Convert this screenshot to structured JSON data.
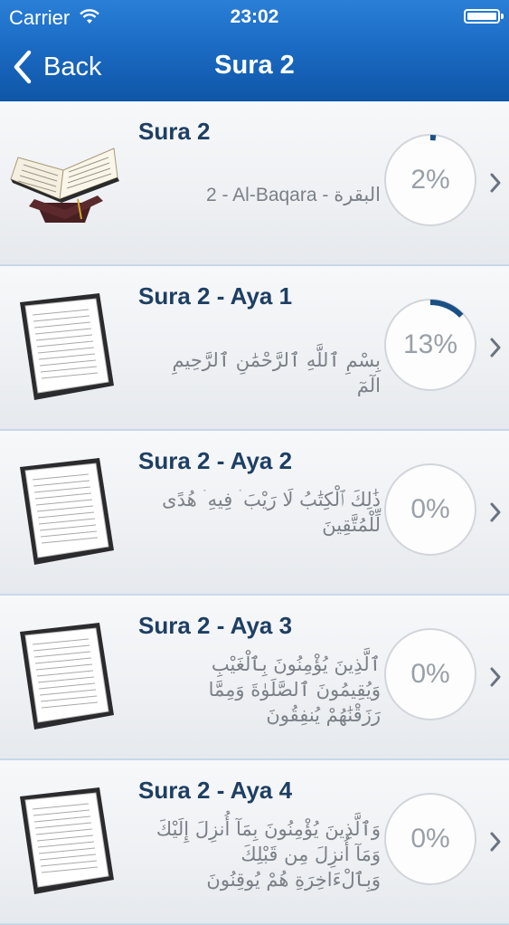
{
  "status": {
    "carrier": "Carrier",
    "time": "23:02"
  },
  "nav": {
    "back_label": "Back",
    "title": "Sura 2"
  },
  "colors": {
    "header": "#1b6bc4",
    "progress": "#1a4f86",
    "title_text": "#1e3f63"
  },
  "rows": [
    {
      "name": "Sura 2",
      "desc": "2 - Al-Baqara - البقرة",
      "progress_label": "2%",
      "progress": 0.02,
      "icon": "quran-book-icon"
    },
    {
      "name": "Sura 2 - Aya 1",
      "desc": "بِسْمِ ٱللَّهِ ٱلرَّحْمَٰنِ ٱلرَّحِيمِ الٓمٓ",
      "progress_label": "13%",
      "progress": 0.13,
      "icon": "document-icon"
    },
    {
      "name": "Sura 2 - Aya 2",
      "desc": "ذَٰلِكَ ٱلْكِتَٰبُ لَا رَيْبَ ۛ فِيهِ ۛ هُدًى لِّلْمُتَّقِينَ",
      "progress_label": "0%",
      "progress": 0,
      "icon": "document-icon"
    },
    {
      "name": "Sura 2 - Aya 3",
      "desc": "ٱلَّذِينَ يُؤْمِنُونَ بِٱلْغَيْبِ وَيُقِيمُونَ ٱلصَّلَوٰةَ وَمِمَّا رَزَقْنَٰهُمْ يُنفِقُونَ",
      "progress_label": "0%",
      "progress": 0,
      "icon": "document-icon"
    },
    {
      "name": "Sura 2 - Aya 4",
      "desc": "وَٱلَّذِينَ يُؤْمِنُونَ بِمَآ أُنزِلَ إِلَيْكَ وَمَآ أُنزِلَ مِن قَبْلِكَ وَبِٱلْءَاخِرَةِ هُمْ يُوقِنُونَ",
      "progress_label": "0%",
      "progress": 0,
      "icon": "document-icon"
    }
  ]
}
